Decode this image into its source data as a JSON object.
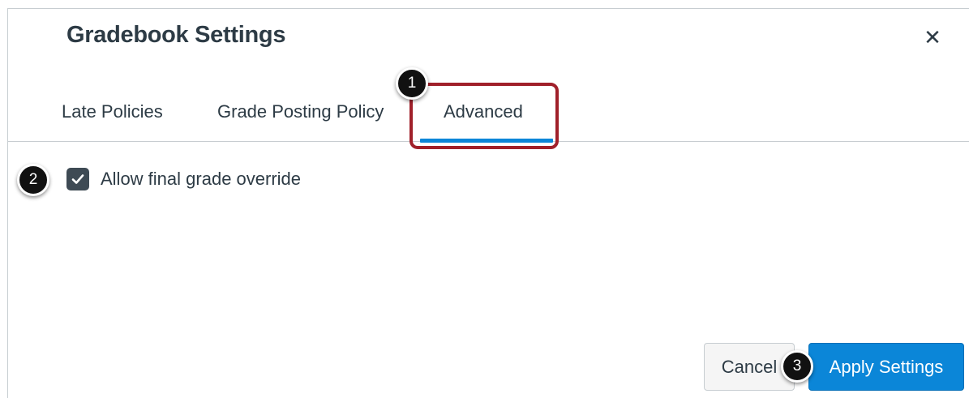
{
  "dialog": {
    "title": "Gradebook Settings",
    "close_icon": "close-icon"
  },
  "tabs": [
    {
      "label": "Late Policies",
      "selected": false
    },
    {
      "label": "Grade Posting Policy",
      "selected": false
    },
    {
      "label": "Advanced",
      "selected": true
    }
  ],
  "advanced": {
    "override_checkbox": {
      "label": "Allow final grade override",
      "checked": true
    }
  },
  "footer": {
    "cancel_label": "Cancel",
    "apply_label": "Apply Settings"
  },
  "callouts": [
    "1",
    "2",
    "3"
  ],
  "colors": {
    "accent": "#0b86d8",
    "highlight": "#a0202a",
    "text": "#2d3b45",
    "checkbox": "#3e4a54"
  }
}
